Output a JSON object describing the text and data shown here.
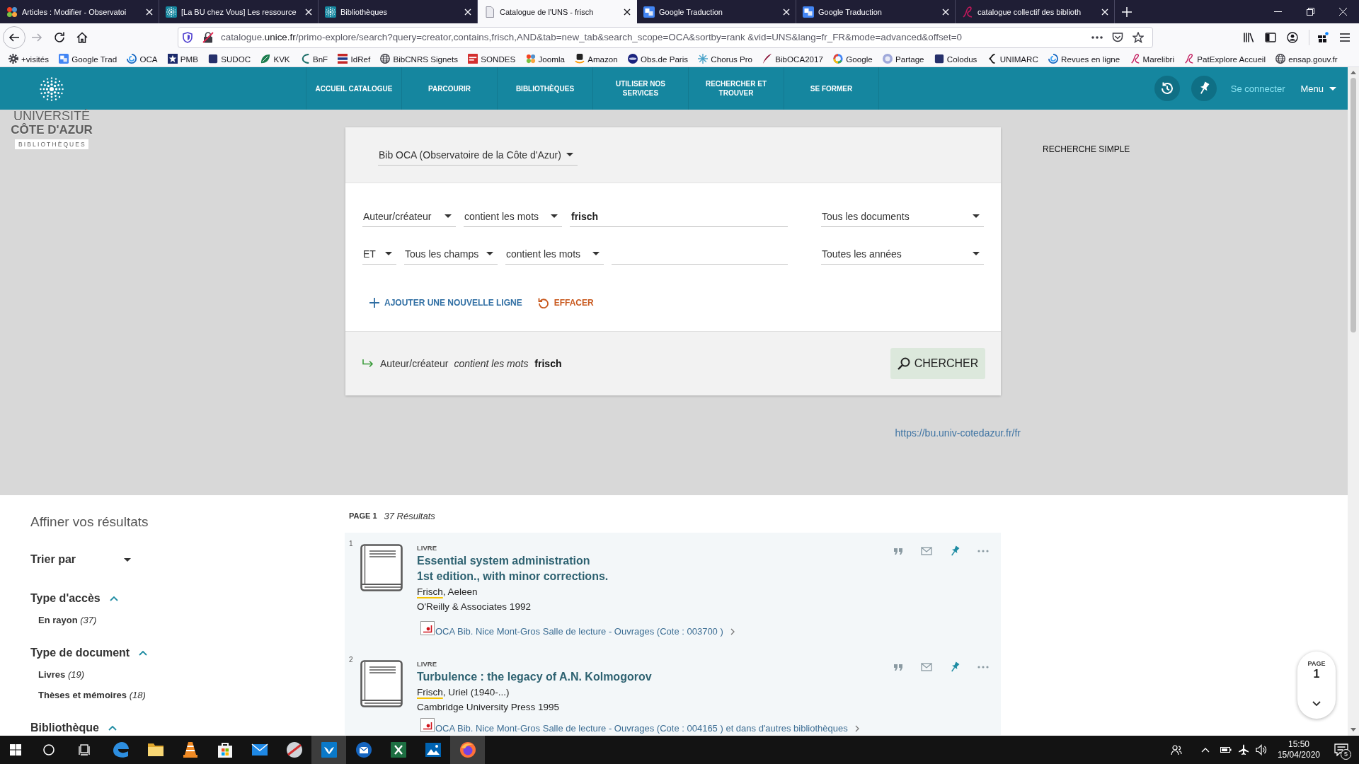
{
  "browser": {
    "tabs": [
      {
        "title": "Articles : Modifier - Observatoi",
        "selected": false
      },
      {
        "title": "[La BU chez Vous] Les ressource",
        "selected": false
      },
      {
        "title": "Bibliothèques",
        "selected": false
      },
      {
        "title": "Catalogue de l'UNS - frisch",
        "selected": true
      },
      {
        "title": "Google Traduction",
        "selected": false
      },
      {
        "title": "Google Traduction",
        "selected": false
      },
      {
        "title": "catalogue collectif des biblioth",
        "selected": false
      }
    ],
    "back_disabled": false,
    "forward_disabled": true,
    "address": {
      "subdomain": "catalogue.",
      "domain": "unice.fr",
      "path": "/primo-explore/search?query=creator,contains,frisch,AND&tab=new_tab&search_scope=OCA&sortby=rank &vid=UNS&lang=fr_FR&mode=advanced&offset=0"
    },
    "bookmarks": [
      "+visités",
      "Google Trad",
      "OCA",
      "PMB",
      "SUDOC",
      "KVK",
      "BnF",
      "IdRef",
      "BibCNRS Signets",
      "SONDES",
      "Joomla",
      "Amazon",
      "Obs.de Paris",
      "Chorus Pro",
      "BibOCA2017",
      "Google",
      "Partage",
      "Colodus",
      "UNIMARC",
      "Revues en ligne",
      "Marelibri",
      "PatExplore Accueil",
      "ensap.gouv.fr"
    ]
  },
  "header": {
    "logo": {
      "title": "UNIVERSITÉ",
      "subtitle": "CÔTE D'AZUR",
      "tagline": "BIBLIOTHÈQUES"
    },
    "nav": [
      "ACCUEIL CATALOGUE",
      "PARCOURIR",
      "BIBLIOTHÈQUES",
      "UTILISER NOS SERVICES",
      "RECHERCHER ET TROUVER",
      "SE FORMER"
    ],
    "login": "Se connecter",
    "menu": "Menu"
  },
  "search": {
    "scope": "Bib OCA (Observatoire de la Côte d'Azur)",
    "rows": [
      {
        "field": "Auteur/créateur",
        "condition": "contient les mots",
        "value": "frisch",
        "filter": "Tous les documents"
      },
      {
        "operator": "ET",
        "field": "Tous les champs",
        "condition": "contient les mots",
        "filter": "Toutes les années"
      }
    ],
    "add_line": "AJOUTER UNE NOUVELLE LIGNE",
    "clear": "EFFACER",
    "summary": "Auteur/créateur *contient les mots* **frisch**",
    "submit": "CHERCHER"
  },
  "simple_search": "RECHERCHE SIMPLE",
  "site_link": "https://bu.univ-cotedazur.fr/fr",
  "facets": {
    "title": "Affiner vos résultats",
    "sort": "Trier par",
    "groups": [
      {
        "title": "Type d'accès",
        "expanded": true,
        "items": [
          "En rayon *(37)*"
        ]
      },
      {
        "title": "Type de document",
        "expanded": true,
        "items": [
          "Livres *(19)*",
          "Thèses et mémoires *(18)*"
        ]
      },
      {
        "title": "Bibliothèque",
        "expanded": true
      }
    ]
  },
  "results": {
    "page": "PAGE 1",
    "count": "37 Résultats",
    "items": [
      {
        "number": "1",
        "type": "LIVRE",
        "title": "Essential system administration",
        "edition": "1st edition., with minor corrections.",
        "author_match": "Frisch",
        "author_rest": ", Aeleen",
        "publisher": "O'Reilly & Associates 1992",
        "availability": "OCA Bib. Nice Mont-Gros Salle de lecture - Ouvrages (Cote : 003700 )"
      },
      {
        "number": "2",
        "type": "LIVRE",
        "title": "Turbulence : the legacy of A.N. Kolmogorov",
        "author_match": "Frisch",
        "author_rest": ", Uriel (1940-...)",
        "publisher": "Cambridge University Press 1995",
        "availability": "OCA Bib. Nice Mont-Gros Salle de lecture - Ouvrages (Cote : 004165 ) et dans d'autres bibliothèques"
      }
    ]
  },
  "page_indicator": {
    "label": "PAGE",
    "number": "1"
  },
  "taskbar": {
    "apps": [
      {
        "kind": "swirl",
        "selected": false
      },
      {
        "kind": "folder",
        "selected": false
      },
      {
        "kind": "cone",
        "selected": false
      },
      {
        "kind": "bag",
        "selected": false
      },
      {
        "kind": "envelope",
        "selected": false
      },
      {
        "kind": "slashed-disc",
        "selected": false
      },
      {
        "kind": "chevron-tile",
        "selected": true
      },
      {
        "kind": "round-mail",
        "selected": false
      },
      {
        "kind": "spreadsheet",
        "selected": false
      },
      {
        "kind": "picture",
        "selected": false
      },
      {
        "kind": "flame-globe",
        "selected": true
      }
    ],
    "time": "15:50",
    "date": "15/04/2020",
    "notifications": "5"
  }
}
